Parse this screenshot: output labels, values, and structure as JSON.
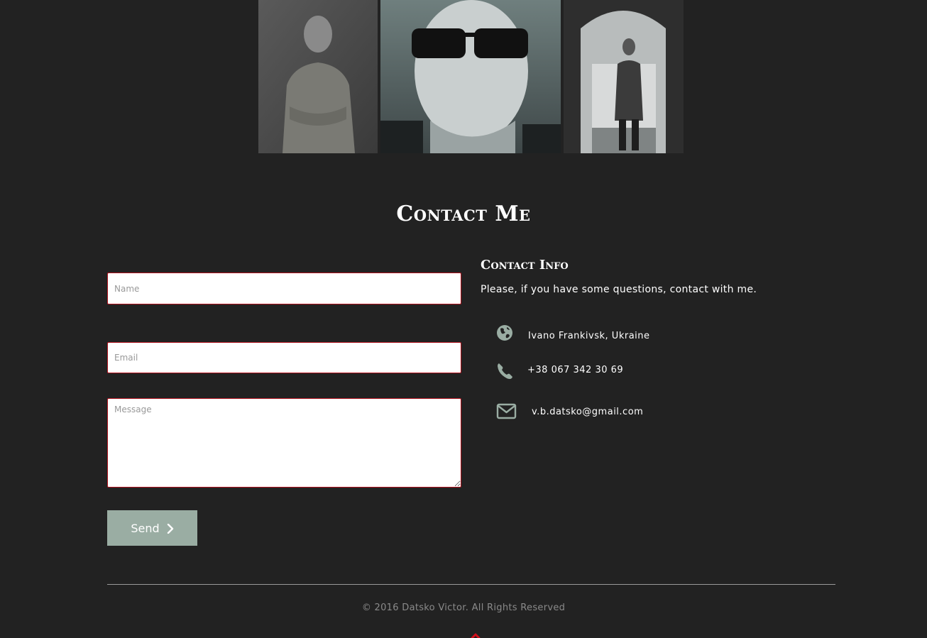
{
  "gallery": {
    "photos": [
      "photo-1",
      "photo-2",
      "photo-3"
    ]
  },
  "section": {
    "title": "Contact Me"
  },
  "form": {
    "name_placeholder": "Name",
    "email_placeholder": "Email",
    "message_placeholder": "Message",
    "send_label": "Send",
    "field_border_color": "#b0121d",
    "button_color": "#9aada3"
  },
  "contact_info": {
    "title": "Contact Info",
    "text": "Please, if you have some questions, contact with me.",
    "location": "Ivano Frankivsk, Ukraine",
    "phone": "+38 067 342 30 69",
    "email": "v.b.datsko@gmail.com",
    "icons": [
      "globe-icon",
      "phone-icon",
      "envelope-icon"
    ],
    "icon_color": "#9aada3"
  },
  "footer": {
    "copyright": "© 2016 Datsko Victor. All Rights Reserved",
    "back_to_top_icon": "chevron-up-icon",
    "accent_color": "#d0101c"
  }
}
